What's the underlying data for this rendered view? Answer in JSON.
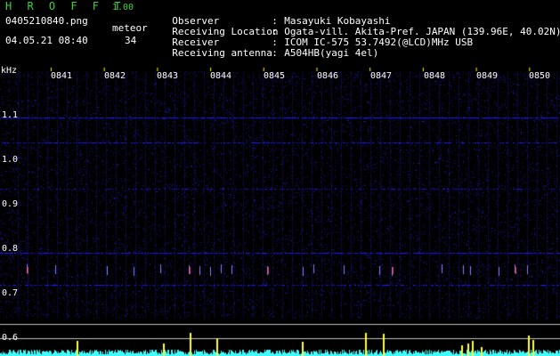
{
  "header": {
    "title": "H R O F F T",
    "version": "1.00",
    "filename": "0405210840.png",
    "datetime": "04.05.21 08:40",
    "meteor_label": "meteor",
    "meteor_count": "34"
  },
  "info": [
    {
      "key": "Observer",
      "value": "Masayuki Kobayashi"
    },
    {
      "key": "Receiving Location",
      "value": "Ogata-vill. Akita-Pref. JAPAN (139.96E, 40.02N)"
    },
    {
      "key": "Receiver",
      "value": "ICOM IC-575 53.7492(@LCD)MHz USB"
    },
    {
      "key": "Receiving antenna",
      "value": "A504HB(yagi 4el)"
    }
  ],
  "plot": {
    "unit_label": "kHz",
    "time_labels": [
      "0841",
      "0842",
      "0843",
      "0844",
      "0845",
      "0846",
      "0847",
      "0848",
      "0849",
      "0850"
    ],
    "freq_labels": [
      "1.1",
      "1.0",
      "0.9",
      "0.8",
      "0.7",
      "0.6"
    ],
    "colors": {
      "background": "#000000",
      "noise": "#1c1cff",
      "signal_bright": "#8080ff",
      "meteor_red": "#ff3030",
      "meteor_yellow": "#ffff40",
      "meteor_cyan": "#40ffff",
      "time_tick": "#ffff00",
      "header_green": "#39d33c"
    }
  }
}
